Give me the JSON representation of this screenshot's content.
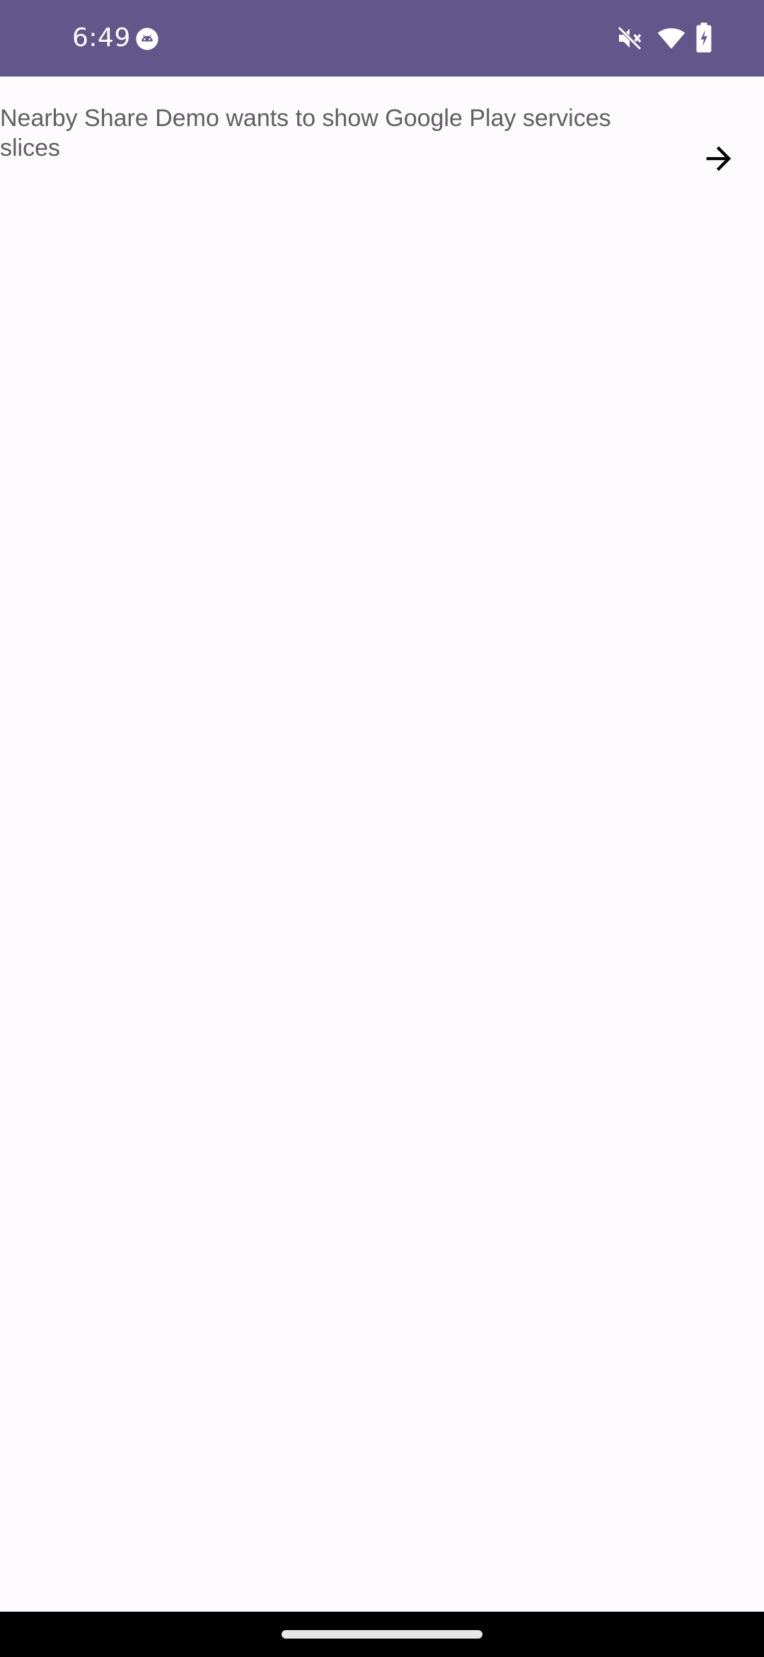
{
  "status_bar": {
    "time": "6:49",
    "app_icon": "android-app-icon",
    "mute_icon": "volume-off-icon",
    "wifi_icon": "wifi-icon",
    "battery_icon": "battery-charging-icon",
    "background_color": "#62568A"
  },
  "slice": {
    "message": "Nearby Share Demo wants to show Google Play services slices",
    "action_icon": "arrow-right-icon"
  },
  "navigation": {
    "home_handle": "gesture-home-handle"
  }
}
